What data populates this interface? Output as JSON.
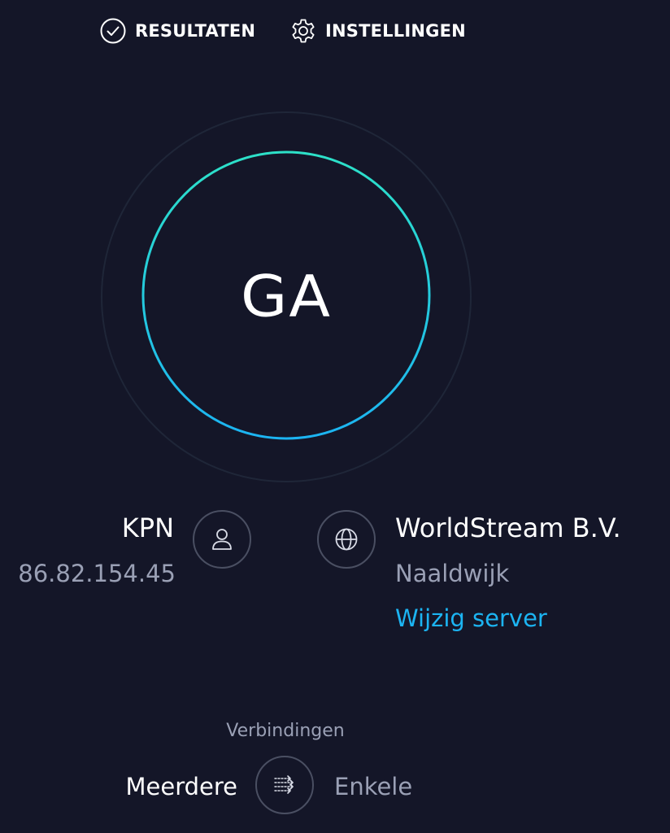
{
  "nav": {
    "results_label": "RESULTATEN",
    "settings_label": "INSTELLINGEN"
  },
  "go_button": {
    "label": "GA"
  },
  "isp": {
    "name": "KPN",
    "ip": "86.82.154.45"
  },
  "server": {
    "name": "WorldStream B.V.",
    "city": "Naaldwijk",
    "change_label": "Wijzig server"
  },
  "connections": {
    "label": "Verbindingen",
    "multi_label": "Meerdere",
    "single_label": "Enkele",
    "selected": "Meerdere"
  },
  "icons": {
    "results": "check-circle-icon",
    "settings": "gear-icon",
    "user": "user-icon",
    "globe": "globe-icon",
    "connections": "connections-arrows-icon"
  },
  "colors": {
    "background": "#141628",
    "ring_gradient_start": "#2de1c8",
    "ring_gradient_end": "#1cb4f2",
    "link": "#1cb4f2",
    "muted_text": "#9aa0b5"
  }
}
